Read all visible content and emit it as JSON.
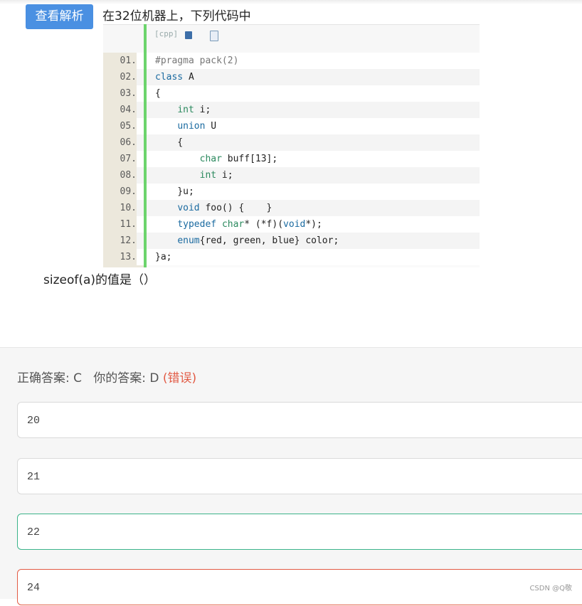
{
  "header": {
    "analysis_button": "查看解析",
    "question_title": "在32位机器上，下列代码中"
  },
  "code": {
    "toolbar_label": "[cpp]",
    "lines": [
      {
        "no": "01.",
        "text": "#pragma pack(2)"
      },
      {
        "no": "02.",
        "text": "class A"
      },
      {
        "no": "03.",
        "text": "{"
      },
      {
        "no": "04.",
        "text": "    int i;"
      },
      {
        "no": "05.",
        "text": "    union U"
      },
      {
        "no": "06.",
        "text": "    {"
      },
      {
        "no": "07.",
        "text": "        char buff[13];"
      },
      {
        "no": "08.",
        "text": "        int i;"
      },
      {
        "no": "09.",
        "text": "    }u;"
      },
      {
        "no": "10.",
        "text": "    void foo() {    }"
      },
      {
        "no": "11.",
        "text": "    typedef char* (*f)(void*);"
      },
      {
        "no": "12.",
        "text": "    enum{red, green, blue} color;"
      },
      {
        "no": "13.",
        "text": "}a;"
      }
    ]
  },
  "question_tail": "sizeof(a)的值是（）",
  "answer": {
    "correct_label": "正确答案: C",
    "your_label": "你的答案: D",
    "status": "(错误)"
  },
  "options": [
    {
      "value": "20",
      "state": "normal"
    },
    {
      "value": "21",
      "state": "normal"
    },
    {
      "value": "22",
      "state": "correct"
    },
    {
      "value": "24",
      "state": "incorrect"
    }
  ],
  "colors": {
    "button": "#4a90e2",
    "correct_border": "#3bb38a",
    "wrong": "#e25b45"
  },
  "watermark": "CSDN @Q敬"
}
